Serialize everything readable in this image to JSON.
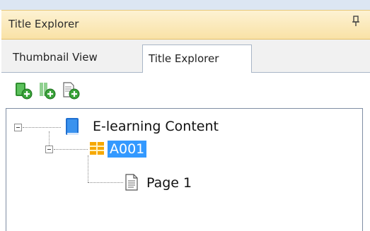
{
  "panel": {
    "title": "Title Explorer",
    "pin_glyph": "ᵽ"
  },
  "tabs": [
    {
      "label": "Thumbnail View",
      "active": false
    },
    {
      "label": "Title Explorer",
      "active": true
    }
  ],
  "toolbar": {
    "buttons": [
      {
        "icon": "add-book-icon"
      },
      {
        "icon": "add-chapter-icon"
      },
      {
        "icon": "add-page-icon"
      }
    ]
  },
  "tree": {
    "root": {
      "label": "E-learning Content",
      "icon": "book-icon",
      "expanded": true
    },
    "child": {
      "label": "A001",
      "icon": "chapter-grid-icon",
      "expanded": true,
      "selected": true
    },
    "grandchild": {
      "label": "Page 1",
      "icon": "page-icon"
    }
  },
  "colors": {
    "selection": "#3399ff",
    "header": "#f9e2a6",
    "book": "#1f6fd0"
  }
}
